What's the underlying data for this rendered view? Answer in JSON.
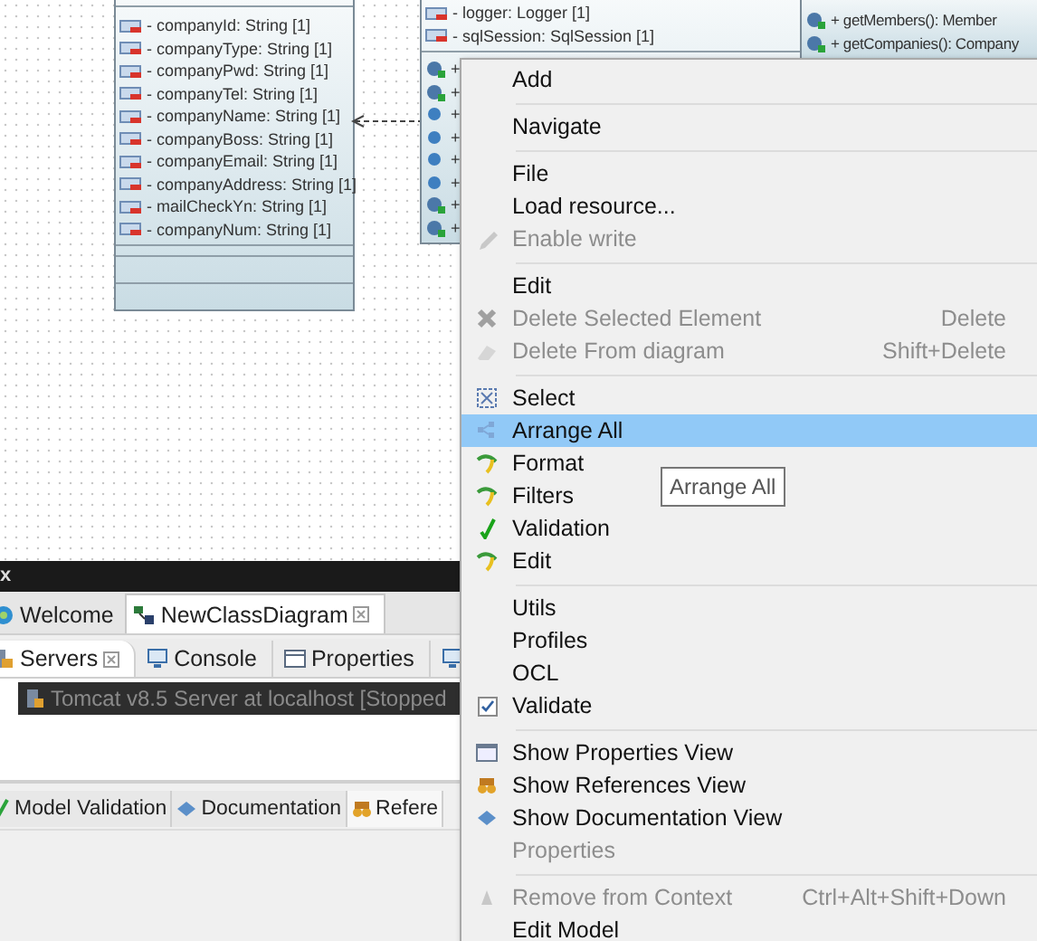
{
  "diagram": {
    "classes": [
      {
        "attributes": [
          "- companyId: String [1]",
          "- companyType: String [1]",
          "- companyPwd: String [1]",
          "- companyTel: String [1]",
          "- companyName: String [1]",
          "- companyBoss: String [1]",
          "- companyEmail: String [1]",
          "- companyAddress: String [1]",
          "- mailCheckYn: String [1]",
          "- companyNum: String [1]"
        ]
      },
      {
        "attributes": [
          "- logger: Logger [1]",
          "- sqlSession: SqlSession [1]"
        ],
        "operations": [
          {
            "kind": "badge",
            "text": "+"
          },
          {
            "kind": "badge",
            "text": "+"
          },
          {
            "kind": "plain",
            "text": "+"
          },
          {
            "kind": "plain",
            "text": "+"
          },
          {
            "kind": "plain",
            "text": "+"
          },
          {
            "kind": "plain",
            "text": "+"
          },
          {
            "kind": "badge",
            "text": "+"
          },
          {
            "kind": "badge",
            "text": "+"
          }
        ]
      },
      {
        "operations": [
          {
            "kind": "badge",
            "text": "+ getMembers(): Member"
          },
          {
            "kind": "badge",
            "text": "+ getCompanies(): Company"
          }
        ]
      }
    ]
  },
  "title_bar": {
    "title": "x"
  },
  "editor_tabs": [
    {
      "label": "Welcome",
      "selected": false
    },
    {
      "label": "NewClassDiagram",
      "selected": true
    }
  ],
  "view_tabs": [
    {
      "label": "Servers",
      "selected": true
    },
    {
      "label": "Console",
      "selected": false
    },
    {
      "label": "Properties",
      "selected": false
    },
    {
      "selected": false
    }
  ],
  "servers": [
    {
      "label": "Tomcat v8.5 Server at localhost  [Stopped",
      "selected": true
    }
  ],
  "bottom_tabs": [
    {
      "label": "Model Validation",
      "selected": false
    },
    {
      "label": "Documentation",
      "selected": false
    },
    {
      "label": "Refere",
      "selected": true
    }
  ],
  "context_menu": {
    "items": [
      {
        "kind": "item",
        "label": "Add",
        "disabled": false,
        "selected": false
      },
      {
        "kind": "separator"
      },
      {
        "kind": "item",
        "label": "Navigate",
        "disabled": false,
        "selected": false
      },
      {
        "kind": "separator"
      },
      {
        "kind": "item",
        "label": "File",
        "disabled": false,
        "selected": false
      },
      {
        "kind": "item",
        "label": "Load resource...",
        "disabled": false,
        "selected": false
      },
      {
        "kind": "item",
        "label": "Enable write",
        "disabled": true,
        "selected": false
      },
      {
        "kind": "separator"
      },
      {
        "kind": "item",
        "label": "Edit",
        "disabled": false,
        "selected": false
      },
      {
        "kind": "item",
        "label": "Delete Selected Element",
        "shortcut": "Delete",
        "disabled": true,
        "selected": false
      },
      {
        "kind": "item",
        "label": "Delete From diagram",
        "shortcut": "Shift+Delete",
        "disabled": true,
        "selected": false
      },
      {
        "kind": "separator"
      },
      {
        "kind": "item",
        "label": "Select",
        "disabled": false,
        "selected": false
      },
      {
        "kind": "item",
        "label": "Arrange All",
        "disabled": false,
        "selected": true
      },
      {
        "kind": "item",
        "label": "Format",
        "disabled": false,
        "selected": false
      },
      {
        "kind": "item",
        "label": "Filters",
        "disabled": false,
        "selected": false
      },
      {
        "kind": "item",
        "label": "Validation",
        "disabled": false,
        "selected": false
      },
      {
        "kind": "item",
        "label": "Edit",
        "disabled": false,
        "selected": false
      },
      {
        "kind": "separator"
      },
      {
        "kind": "item",
        "label": "Utils",
        "disabled": false,
        "selected": false
      },
      {
        "kind": "item",
        "label": "Profiles",
        "disabled": false,
        "selected": false
      },
      {
        "kind": "item",
        "label": "OCL",
        "disabled": false,
        "selected": false
      },
      {
        "kind": "item",
        "label": "Validate",
        "disabled": false,
        "selected": false,
        "checked": true
      },
      {
        "kind": "separator"
      },
      {
        "kind": "item",
        "label": "Show Properties View",
        "disabled": false,
        "selected": false
      },
      {
        "kind": "item",
        "label": "Show References View",
        "disabled": false,
        "selected": false
      },
      {
        "kind": "item",
        "label": "Show Documentation View",
        "disabled": false,
        "selected": false
      },
      {
        "kind": "item",
        "label": "Properties",
        "disabled": true,
        "selected": false
      },
      {
        "kind": "separator"
      },
      {
        "kind": "item",
        "label": "Remove from Context",
        "shortcut": "Ctrl+Alt+Shift+Down",
        "disabled": true,
        "selected": false
      },
      {
        "kind": "item",
        "label": "Edit Model",
        "disabled": false,
        "selected": false
      }
    ]
  },
  "tooltip": {
    "text": "Arrange All"
  }
}
